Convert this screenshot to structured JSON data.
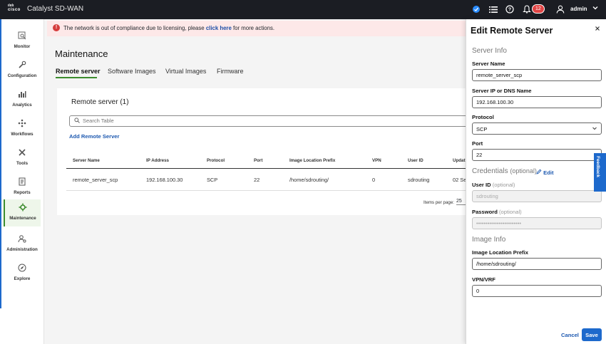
{
  "app": {
    "brand": "cisco",
    "title": "Catalyst SD-WAN",
    "notification_count": "12",
    "user": "admin"
  },
  "sidebar": {
    "items": [
      {
        "label": "Monitor",
        "icon": "monitor-icon"
      },
      {
        "label": "Configuration",
        "icon": "configuration-icon"
      },
      {
        "label": "Analytics",
        "icon": "analytics-icon"
      },
      {
        "label": "Workflows",
        "icon": "workflows-icon"
      },
      {
        "label": "Tools",
        "icon": "tools-icon"
      },
      {
        "label": "Reports",
        "icon": "reports-icon"
      },
      {
        "label": "Maintenance",
        "icon": "maintenance-icon"
      },
      {
        "label": "Administration",
        "icon": "administration-icon"
      },
      {
        "label": "Explore",
        "icon": "explore-icon"
      }
    ],
    "active": "Maintenance"
  },
  "alert": {
    "text": "The network is out of compliance due to licensing, please",
    "link": "click here",
    "suffix": "for more actions."
  },
  "page": {
    "title": "Maintenance",
    "tabs": [
      "Remote server",
      "Software Images",
      "Virtual Images",
      "Firmware"
    ],
    "card_title": "Remote server (1)",
    "search_placeholder": "Search Table",
    "add_link": "Add Remote Server",
    "table": {
      "headers": [
        "Server Name",
        "IP Address",
        "Protocol",
        "Port",
        "Image Location Prefix",
        "VPN",
        "User ID",
        "Updat"
      ],
      "rows": [
        [
          "remote_server_scp",
          "192.168.100.30",
          "SCP",
          "22",
          "/home/sdrouting/",
          "0",
          "sdrouting",
          "02 Se"
        ]
      ]
    },
    "items_per_page_label": "Items per page:",
    "items_per_page": "25"
  },
  "drawer": {
    "title": "Edit Remote Server",
    "server_info": "Server Info",
    "server_name_label": "Server Name",
    "server_name": "remote_server_scp",
    "server_ip_label": "Server IP or DNS Name",
    "server_ip": "192.168.100.30",
    "protocol_label": "Protocol",
    "protocol": "SCP",
    "port_label": "Port",
    "port": "22",
    "credentials": "Credentials",
    "credentials_opt": "(optional)",
    "edit_label": "Edit",
    "user_id_label": "User ID",
    "user_id_opt": "(optional)",
    "user_id": "sdrouting",
    "password_label": "Password",
    "password_opt": "(optional)",
    "password_mask": "••••••••••••••••••••••••",
    "image_info": "Image Info",
    "prefix_label": "Image Location Prefix",
    "prefix": "/home/sdrouting/",
    "vpn_label": "VPN/VRF",
    "vpn": "0",
    "cancel": "Cancel",
    "save": "Save"
  },
  "feedback": "Feedback"
}
